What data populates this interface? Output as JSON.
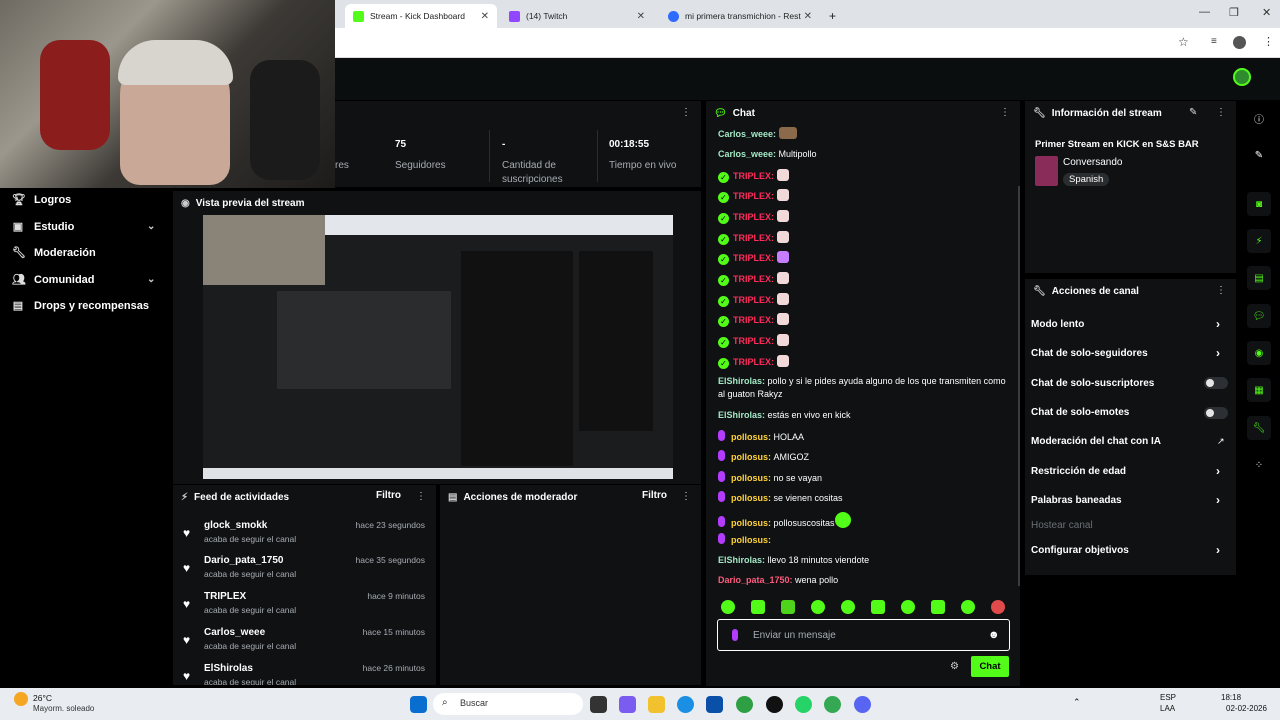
{
  "browser": {
    "tabs": [
      {
        "title": "Stream - Kick Dashboard",
        "active": true
      },
      {
        "title": "(14) Twitch",
        "active": false
      },
      {
        "title": "mi primera transmichion - Rest",
        "active": false
      }
    ],
    "new_tab": "+"
  },
  "leftnav": {
    "items": [
      {
        "label": "Logros",
        "icon": "trophy-icon"
      },
      {
        "label": "Estudio",
        "icon": "studio-icon",
        "expandable": true
      },
      {
        "label": "Moderación",
        "icon": "wrench-icon"
      },
      {
        "label": "Comunidad",
        "icon": "community-icon",
        "expandable": true
      },
      {
        "label": "Drops y recompensas",
        "icon": "drops-icon"
      }
    ]
  },
  "stats": {
    "partial_label": "res",
    "followers_value": "75",
    "followers_label": "Seguidores",
    "subs_value": "-",
    "subs_label_1": "Cantidad de",
    "subs_label_2": "suscripciones",
    "live_value": "00:18:55",
    "live_label": "Tiempo en vivo"
  },
  "preview": {
    "title": "Vista previa del stream"
  },
  "activity": {
    "title": "Feed de actividades",
    "filter": "Filtro",
    "items": [
      {
        "name": "glock_smokk",
        "time": "hace 23 segundos",
        "sub": "acaba de seguir el canal"
      },
      {
        "name": "Dario_pata_1750",
        "time": "hace 35 segundos",
        "sub": "acaba de seguir el canal"
      },
      {
        "name": "TRIPLEX",
        "time": "hace 9 minutos",
        "sub": "acaba de seguir el canal"
      },
      {
        "name": "Carlos_weee",
        "time": "hace 15 minutos",
        "sub": "acaba de seguir el canal"
      },
      {
        "name": "ElShirolas",
        "time": "hace 26 minutos",
        "sub": "acaba de seguir el canal"
      }
    ]
  },
  "modactions": {
    "title": "Acciones de moderador",
    "filter": "Filtro"
  },
  "chat": {
    "title": "Chat",
    "messages": [
      {
        "user": "Carlos_weee",
        "text": "",
        "style": "teal",
        "badge": "none",
        "emote": "brown"
      },
      {
        "user": "Carlos_weee",
        "text": "Multipollo",
        "style": "teal",
        "badge": "none",
        "emote": ""
      },
      {
        "user": "TRIPLEX",
        "text": "",
        "style": "red",
        "badge": "verified",
        "emote": "pink"
      },
      {
        "user": "TRIPLEX",
        "text": "",
        "style": "red",
        "badge": "verified",
        "emote": "pink"
      },
      {
        "user": "TRIPLEX",
        "text": "",
        "style": "red",
        "badge": "verified",
        "emote": "pink"
      },
      {
        "user": "TRIPLEX",
        "text": "",
        "style": "red",
        "badge": "verified",
        "emote": "pink"
      },
      {
        "user": "TRIPLEX",
        "text": "",
        "style": "red",
        "badge": "verified",
        "emote": "purple"
      },
      {
        "user": "TRIPLEX",
        "text": "",
        "style": "red",
        "badge": "verified",
        "emote": "pink"
      },
      {
        "user": "TRIPLEX",
        "text": "",
        "style": "red",
        "badge": "verified",
        "emote": "pink"
      },
      {
        "user": "TRIPLEX",
        "text": "",
        "style": "red",
        "badge": "verified",
        "emote": "pink"
      },
      {
        "user": "TRIPLEX",
        "text": "",
        "style": "red",
        "badge": "verified",
        "emote": "pink"
      },
      {
        "user": "TRIPLEX",
        "text": "",
        "style": "red",
        "badge": "verified",
        "emote": "pink"
      }
    ],
    "long_message": {
      "user": "ElShirolas",
      "text": "pollo y si le pides ayuda alguno de los que transmiten como al guaton Rakyz"
    },
    "messages2": [
      {
        "user": "ElShirolas",
        "text": "estás en vivo en kick",
        "style": "teal",
        "badge": "none"
      },
      {
        "user": "pollosus",
        "text": "HOLAA",
        "style": "yellow",
        "badge": "mic"
      },
      {
        "user": "pollosus",
        "text": "AMIGOZ",
        "style": "yellow",
        "badge": "mic"
      },
      {
        "user": "pollosus",
        "text": "no se vayan",
        "style": "yellow",
        "badge": "mic"
      },
      {
        "user": "pollosus",
        "text": "se vienen cositas",
        "style": "yellow",
        "badge": "mic"
      },
      {
        "user": "pollosus",
        "text": "pollosuscositas",
        "style": "yellow",
        "badge": "mic"
      },
      {
        "user": "pollosus",
        "text": "",
        "style": "yellow",
        "badge": "mic"
      },
      {
        "user": "ElShirolas",
        "text": "llevo 18 minutos viendote",
        "style": "teal",
        "badge": "none"
      },
      {
        "user": "Dario_pata_1750",
        "text": "wena pollo",
        "style": "pink",
        "badge": "none"
      }
    ],
    "input_placeholder": "Enviar un mensaje",
    "send_label": "Chat"
  },
  "streaminfo": {
    "title": "Información del stream",
    "stream_title": "Primer Stream en KICK en S&S BAR",
    "category": "Conversando",
    "language": "Spanish"
  },
  "channel_actions": {
    "title": "Acciones de canal",
    "items": [
      {
        "label": "Modo lento",
        "control": "chevron"
      },
      {
        "label": "Chat de solo-seguidores",
        "control": "chevron"
      },
      {
        "label": "Chat de solo-suscriptores",
        "control": "toggle"
      },
      {
        "label": "Chat de solo-emotes",
        "control": "toggle"
      },
      {
        "label": "Moderación del chat con IA",
        "control": "external"
      },
      {
        "label": "Restricción de edad",
        "control": "chevron"
      },
      {
        "label": "Palabras baneadas",
        "control": "chevron"
      },
      {
        "label": "Hostear canal",
        "control": "none",
        "disabled": true
      },
      {
        "label": "Configurar objetivos",
        "control": "chevron"
      }
    ]
  },
  "taskbar": {
    "weather_temp": "26°C",
    "weather_desc": "Mayorm. soleado",
    "search": "Buscar",
    "lang_1": "ESP",
    "lang_2": "LAA",
    "time": "18:18",
    "date": "02-02-2026"
  },
  "colors": {
    "accent": "#53fc18",
    "panel": "#0f1113",
    "background": "#000000"
  }
}
